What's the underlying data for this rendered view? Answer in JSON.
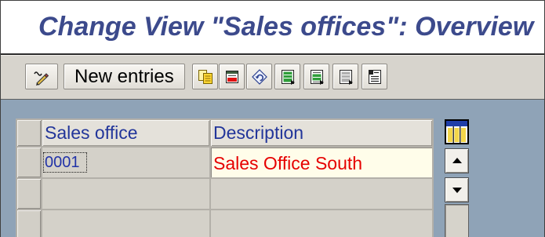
{
  "window": {
    "title": "Change View \"Sales offices\": Overview"
  },
  "toolbar": {
    "display_change": {
      "icon": "display-change-icon"
    },
    "new_entries": {
      "label": "New entries"
    },
    "icon_buttons": [
      {
        "icon": "copy-as-icon"
      },
      {
        "icon": "delete-icon"
      },
      {
        "icon": "undo-change-icon"
      },
      {
        "icon": "select-all-icon"
      },
      {
        "icon": "select-block-icon"
      },
      {
        "icon": "deselect-all-icon"
      },
      {
        "icon": "list-icon"
      }
    ]
  },
  "table": {
    "settings_icon": "table-settings-icon",
    "columns": [
      {
        "label": "Sales office"
      },
      {
        "label": "Description"
      }
    ],
    "rows": [
      {
        "sales_office": "0001",
        "description": "Sales Office South"
      },
      {
        "sales_office": "",
        "description": ""
      },
      {
        "sales_office": "",
        "description": ""
      }
    ]
  },
  "scrollbar": {
    "up_icon": "scroll-up-icon",
    "down_icon": "scroll-down-icon"
  },
  "colors": {
    "title_text": "#3c4a8c",
    "screen_background": "#8fa3b7",
    "toolbar_background": "#d7d4cd",
    "header_text": "#22359a",
    "key_text": "#2233a8",
    "description_text": "#e60000",
    "input_background": "#fffdea"
  }
}
